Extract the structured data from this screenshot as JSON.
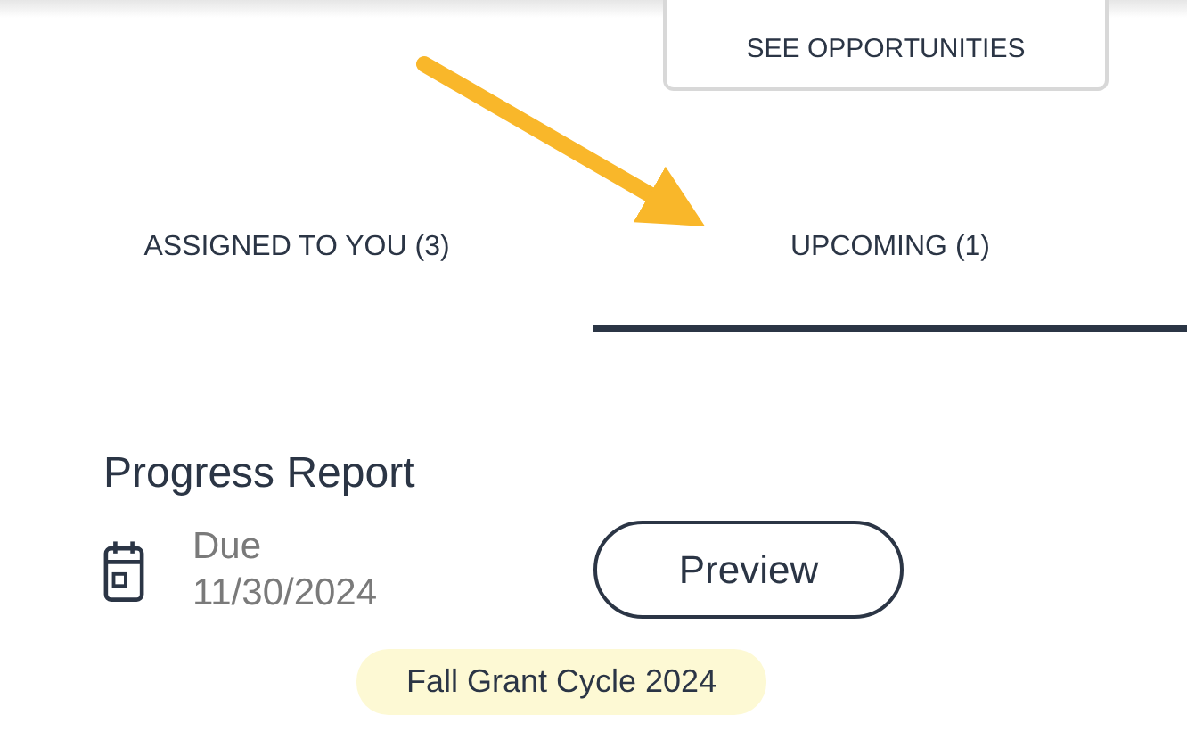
{
  "header": {
    "button": "SEE OPPORTUNITIES"
  },
  "tabs": [
    {
      "label": "ASSIGNED TO YOU (3)",
      "selected": false
    },
    {
      "label": "UPCOMING (1)",
      "selected": true
    }
  ],
  "task": {
    "title": "Progress Report",
    "due_label": "Due",
    "due_date": "11/30/2024",
    "button": "Preview",
    "tag": "Fall Grant Cycle 2024"
  }
}
